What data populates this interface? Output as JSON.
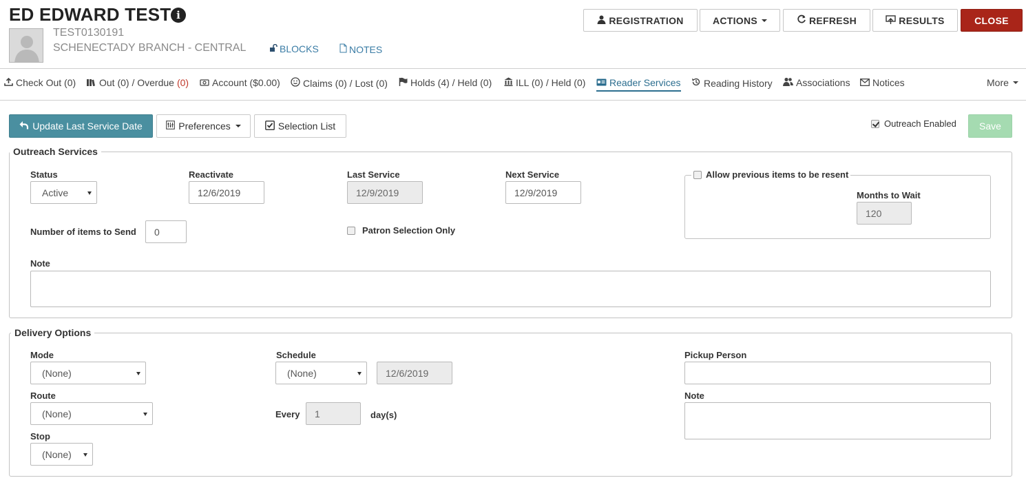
{
  "patron": {
    "name": "ED EDWARD TEST",
    "barcode": "TEST0130191",
    "branch": "SCHENECTADY BRANCH - CENTRAL",
    "blocks_label": "BLOCKS",
    "notes_label": "NOTES"
  },
  "header_buttons": {
    "registration": "REGISTRATION",
    "actions": "ACTIONS",
    "refresh": "REFRESH",
    "results": "RESULTS",
    "close": "CLOSE"
  },
  "tabs": [
    {
      "label": "Check Out (0)"
    },
    {
      "label": "Out (0) / Overdue ",
      "red": "(0)"
    },
    {
      "label": "Account ($0.00)"
    },
    {
      "label": "Claims (0) / Lost (0)"
    },
    {
      "label": "Holds (4) / Held (0)"
    },
    {
      "label": "ILL (0) / Held (0)"
    },
    {
      "label": "Reader Services"
    },
    {
      "label": "Reading History"
    },
    {
      "label": "Associations"
    },
    {
      "label": "Notices"
    },
    {
      "label": "More"
    }
  ],
  "toolbar": {
    "update_last_service": "Update Last Service Date",
    "preferences": "Preferences",
    "selection_list": "Selection List",
    "outreach_enabled": "Outreach Enabled",
    "outreach_enabled_checked": true,
    "save": "Save"
  },
  "outreach": {
    "legend": "Outreach Services",
    "status_label": "Status",
    "status_value": "Active",
    "reactivate_label": "Reactivate",
    "reactivate_value": "12/6/2019",
    "last_service_label": "Last Service",
    "last_service_value": "12/9/2019",
    "next_service_label": "Next Service",
    "next_service_value": "12/9/2019",
    "allow_resent_label": "Allow previous items to be resent",
    "months_to_wait_label": "Months to Wait",
    "months_to_wait_value": "120",
    "items_to_send_label": "Number of items to Send",
    "items_to_send_value": "0",
    "patron_selection_only_label": "Patron Selection Only",
    "note_label": "Note",
    "note_value": ""
  },
  "delivery": {
    "legend": "Delivery Options",
    "mode_label": "Mode",
    "mode_value": "(None)",
    "route_label": "Route",
    "route_value": "(None)",
    "stop_label": "Stop",
    "stop_value": "(None)",
    "schedule_label": "Schedule",
    "schedule_value": "(None)",
    "schedule_date": "12/6/2019",
    "every_label": "Every",
    "every_value": "1",
    "every_unit": "day(s)",
    "pickup_person_label": "Pickup Person",
    "pickup_person_value": "",
    "note_label": "Note",
    "note_value": ""
  }
}
